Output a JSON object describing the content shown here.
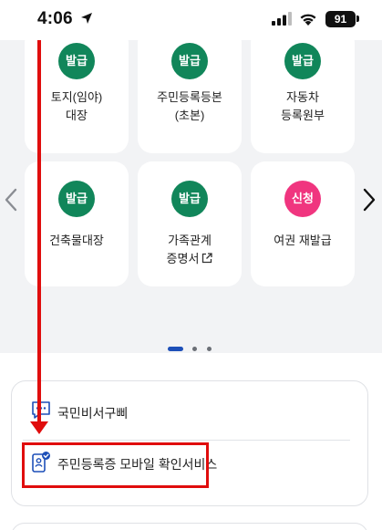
{
  "status_bar": {
    "time": "4:06",
    "battery": "91",
    "icons": [
      "location-arrow-icon",
      "cellular-signal-icon",
      "wifi-icon",
      "battery-icon"
    ]
  },
  "services": [
    {
      "badge": "발급",
      "badge_color": "#11865a",
      "label_lines": [
        "토지(임야)",
        "대장"
      ]
    },
    {
      "badge": "발급",
      "badge_color": "#11865a",
      "label_lines": [
        "주민등록등본",
        "(초본)"
      ]
    },
    {
      "badge": "발급",
      "badge_color": "#11865a",
      "label_lines": [
        "자동차",
        "등록원부"
      ]
    },
    {
      "badge": "발급",
      "badge_color": "#11865a",
      "label_lines": [
        "건축물대장"
      ]
    },
    {
      "badge": "발급",
      "badge_color": "#11865a",
      "label_lines": [
        "가족관계",
        "증명서"
      ],
      "external_link_icon": "external-link-icon"
    },
    {
      "badge": "신청",
      "badge_color": "#f0357f",
      "label_lines": [
        "여권 재발급"
      ]
    }
  ],
  "carousel": {
    "page_count": 3,
    "current_page": 1,
    "active_color": "#1d4fb8"
  },
  "menu": [
    {
      "label": "국민비서구삐",
      "icon": "chat-bubble-icon"
    },
    {
      "label": "주민등록증 모바일 확인서비스",
      "icon": "mobile-id-verified-icon"
    }
  ],
  "annotation": {
    "color": "#e00d0d",
    "target": "주민등록증 모바일 확인서비스"
  },
  "colors": {
    "background": "#f2f3f5",
    "card": "#ffffff",
    "brand_blue": "#1d4fb8"
  }
}
